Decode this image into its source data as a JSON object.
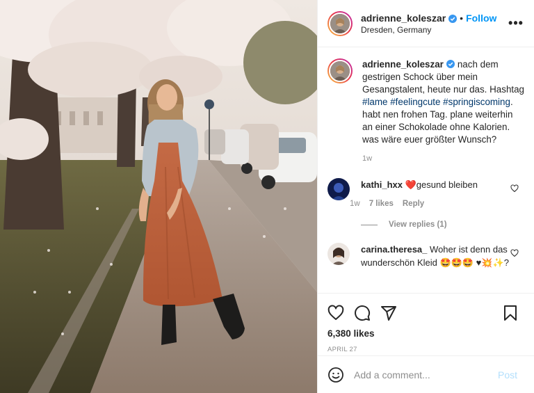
{
  "post": {
    "author": {
      "username": "adrienne_koleszar",
      "verified_icon": "verified-badge-icon",
      "follow_label": "Follow",
      "separator": "•",
      "location": "Dresden, Germany"
    },
    "more_icon": "more-options-icon",
    "more_label": "•••",
    "caption": {
      "username": "adrienne_koleszar",
      "text_before": "nach dem gestrigen Schock über mein Gesangstalent, heute nur das. Hashtag ",
      "tags": [
        "#lame",
        "#feelingcute",
        "#springiscoming"
      ],
      "text_after": ". habt nen frohen Tag. plane weiterhin an einer Schokolade ohne Kalorien. was wäre euer größter Wunsch?",
      "time": "1w"
    },
    "comments": [
      {
        "username": "kathi_hxx",
        "emoji": "❤️",
        "text": "gesund bleiben",
        "time": "1w",
        "likes": "7 likes",
        "reply_label": "Reply",
        "view_replies": "View replies (1)"
      },
      {
        "username": "carina.theresa_",
        "text": "Woher ist denn das wunderschön Kleid",
        "emoji_tail": "🤩🤩🤩 ♥💥✨?"
      }
    ],
    "actions": {
      "like_icon": "heart-icon",
      "comment_icon": "comment-icon",
      "share_icon": "share-icon",
      "save_icon": "bookmark-icon"
    },
    "likes": "6,380 likes",
    "date": "APRIL 27",
    "add_comment": {
      "emoji_icon": "emoji-icon",
      "placeholder": "Add a comment...",
      "post_label": "Post"
    }
  },
  "colors": {
    "accent": "#0095f6",
    "hashtag": "#00376b",
    "muted": "#8e8e8e",
    "heart_red": "#ed4956"
  }
}
